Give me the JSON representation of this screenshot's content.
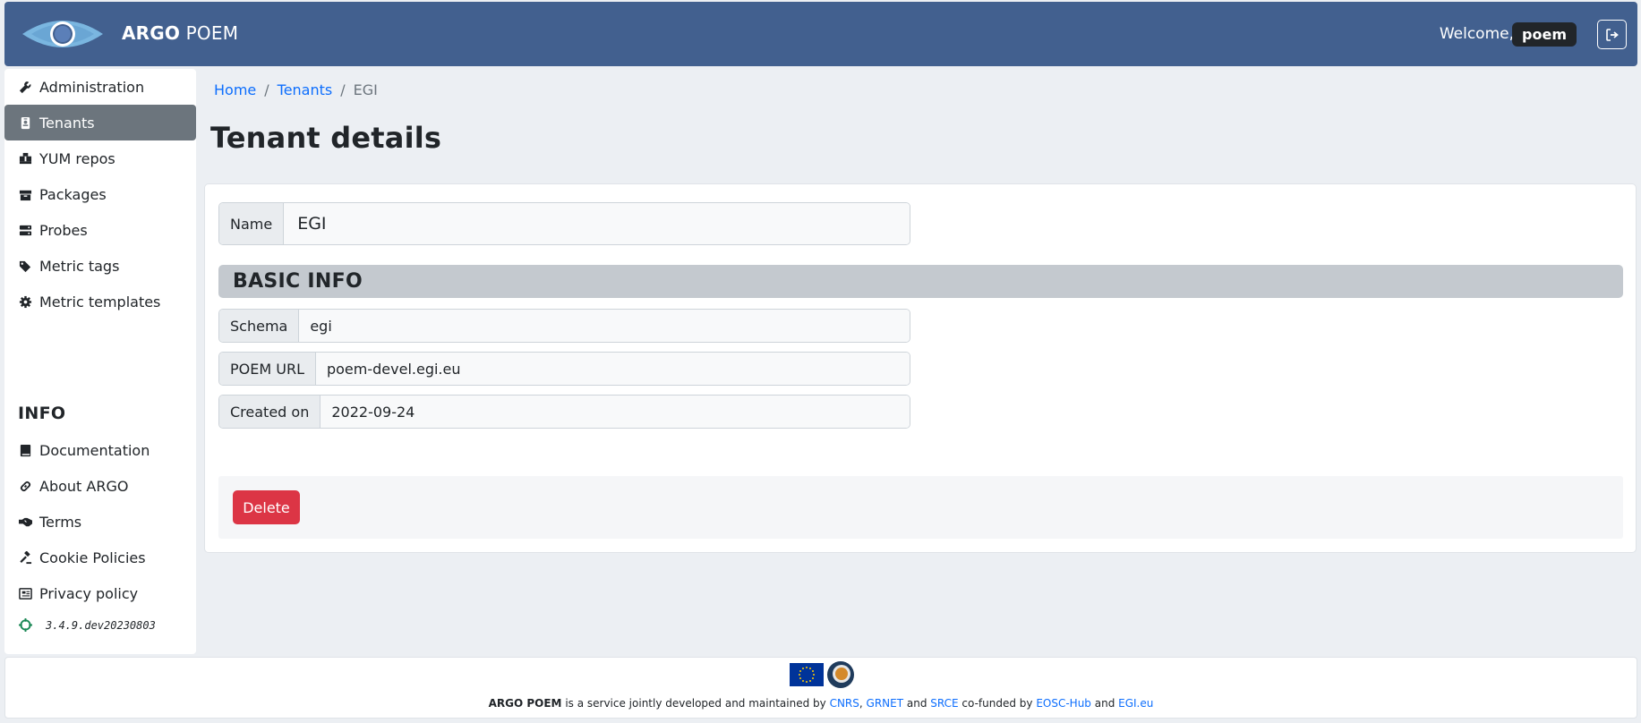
{
  "header": {
    "brand_bold": "ARGO",
    "brand_rest": " POEM",
    "welcome": "Welcome,",
    "username": "poem",
    "logo_icon": "argo-eye-logo",
    "logout_icon": "sign-out-icon"
  },
  "sidebar": {
    "items": [
      {
        "label": "Administration",
        "icon": "wrench-icon"
      },
      {
        "label": "Tenants",
        "icon": "id-badge-icon"
      },
      {
        "label": "YUM repos",
        "icon": "boxes-icon"
      },
      {
        "label": "Packages",
        "icon": "box-icon"
      },
      {
        "label": "Probes",
        "icon": "server-icon"
      },
      {
        "label": "Metric tags",
        "icon": "tags-icon"
      },
      {
        "label": "Metric templates",
        "icon": "cog-icon"
      }
    ],
    "active": "Tenants",
    "info_heading": "INFO",
    "info_items": [
      {
        "label": "Documentation",
        "icon": "book-icon"
      },
      {
        "label": "About ARGO",
        "icon": "link-icon"
      },
      {
        "label": "Terms",
        "icon": "handshake-icon"
      },
      {
        "label": "Cookie Policies",
        "icon": "gavel-icon"
      },
      {
        "label": "Privacy policy",
        "icon": "newspaper-icon"
      }
    ],
    "version": "3.4.9.dev20230803"
  },
  "breadcrumb": {
    "home": "Home",
    "sep": "/",
    "tenants": "Tenants",
    "current": "EGI"
  },
  "page": {
    "title": "Tenant details"
  },
  "form": {
    "name_label": "Name",
    "name_value": "EGI",
    "section_title": "BASIC INFO",
    "schema_label": "Schema",
    "schema_value": "egi",
    "url_label": "POEM URL",
    "url_value": "poem-devel.egi.eu",
    "created_label": "Created on",
    "created_value": "2022-09-24",
    "delete_label": "Delete"
  },
  "footer": {
    "brand": "ARGO POEM",
    "text1": " is a service jointly developed and maintained by ",
    "cnrs": "CNRS",
    "comma": ", ",
    "grnet": "GRNET",
    "and1": " and ",
    "srce": "SRCE",
    "cofunded": " co-funded by ",
    "eosc": "EOSC-Hub",
    "and2": " and ",
    "egi": "EGI.eu"
  },
  "colors": {
    "header_bg": "#42608f",
    "active_nav": "#6c757d",
    "link": "#0d6efd",
    "danger": "#dc3545",
    "section_bg": "#c4c9cf"
  }
}
